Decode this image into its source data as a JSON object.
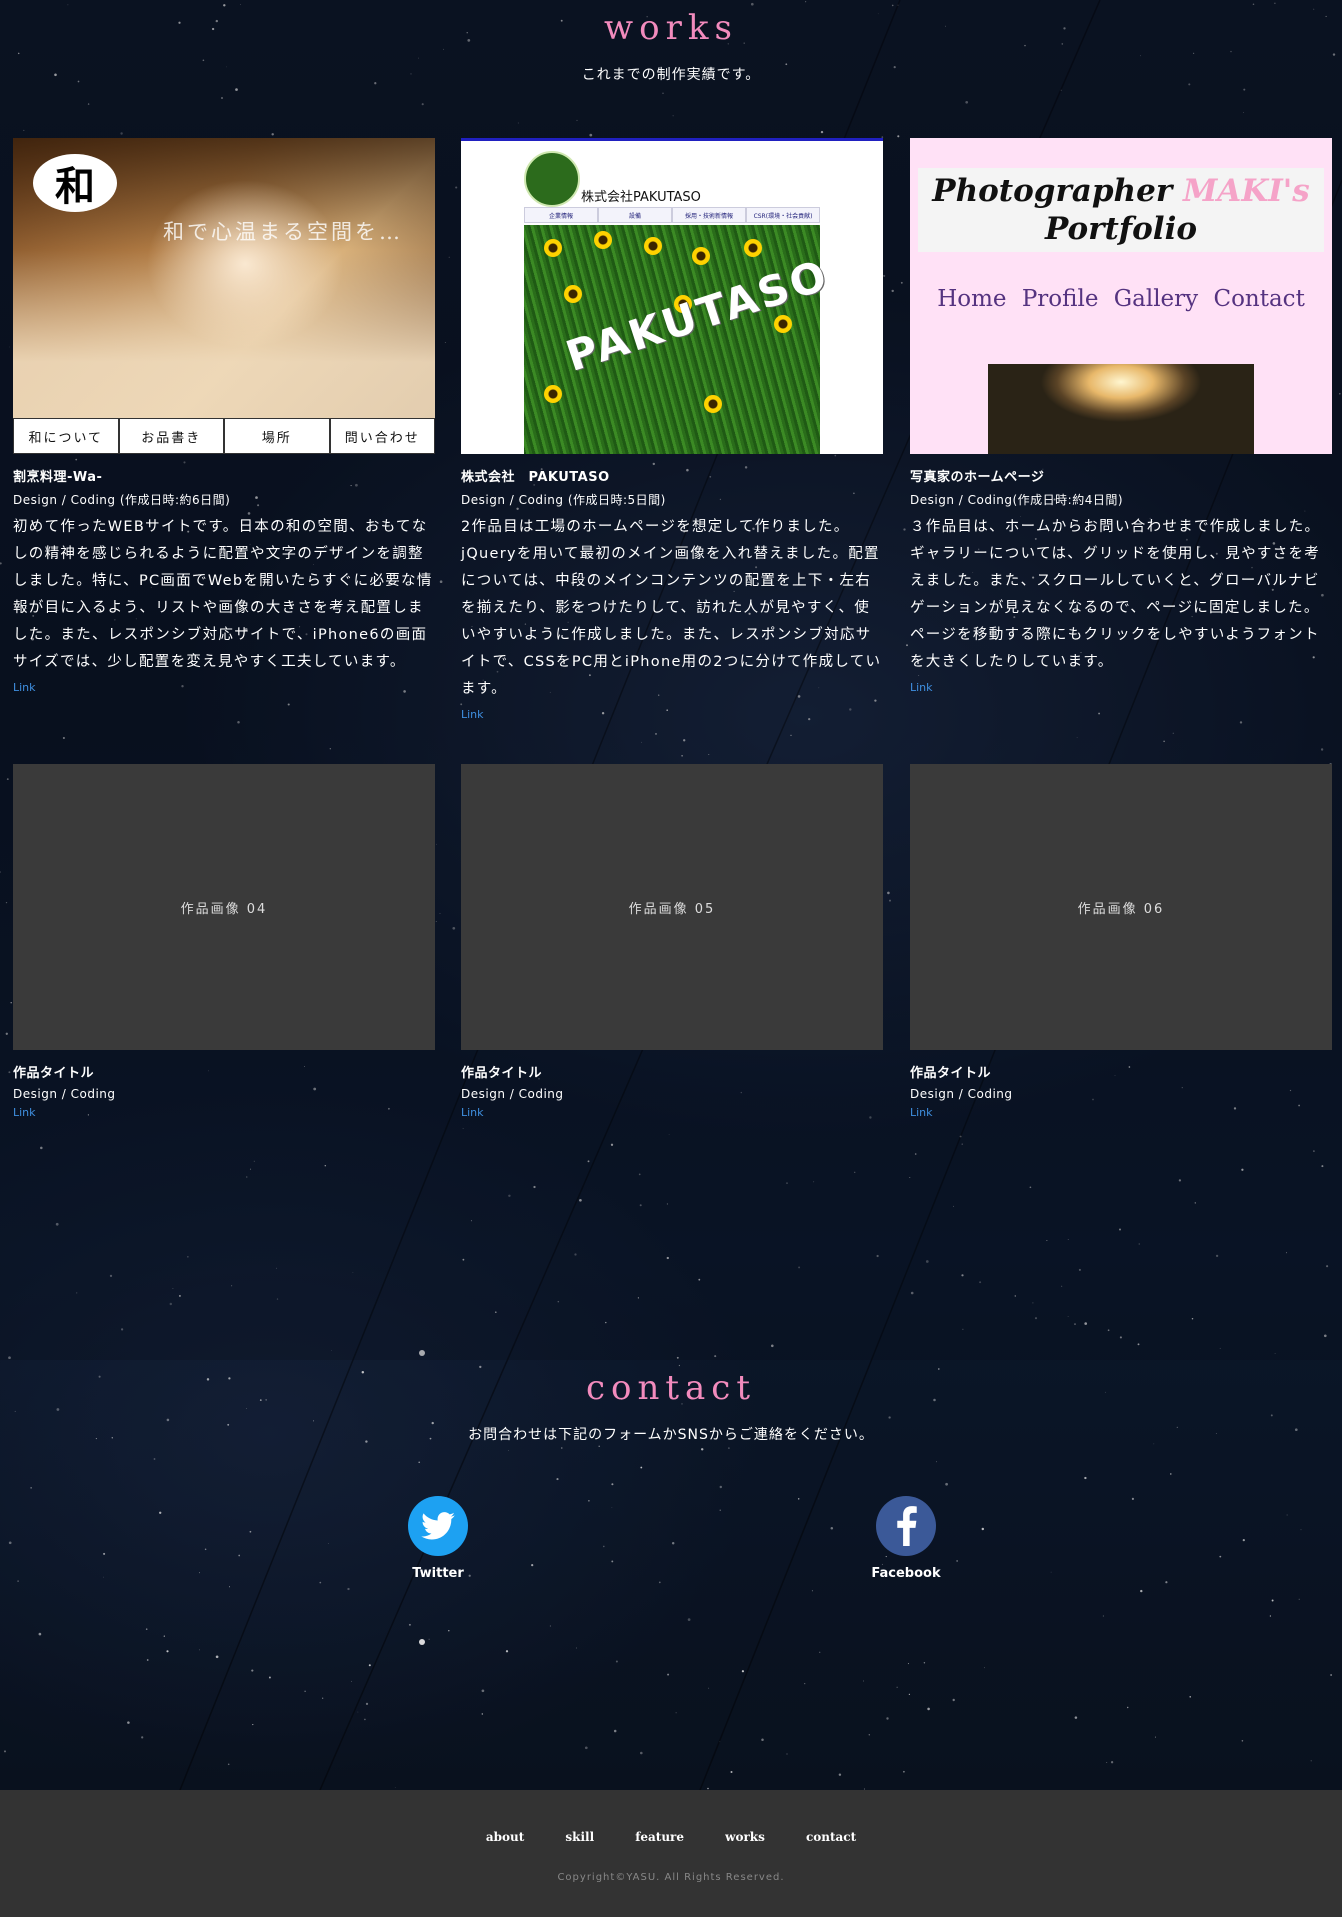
{
  "works": {
    "title": "works",
    "subtitle": "これまでの制作実績です。",
    "items": [
      {
        "title": "割烹料理-Wa-",
        "meta": "Design / Coding (作成日時:約6日間)",
        "desc": "初めて作ったWEBサイトです。日本の和の空間、おもてなしの精神を感じられるように配置や文字のデザインを調整しました。特に、PC画面でWebを開いたらすぐに必要な情報が目に入るよう、リストや画像の大きさを考え配置しました。また、レスポンシブ対応サイトで、iPhone6の画面サイズでは、少し配置を変え見やすく工夫しています。",
        "link": "Link",
        "thumb": {
          "logo": "和",
          "catch": "和で心温まる空間を…",
          "nav": [
            "和について",
            "お品書き",
            "場所",
            "問い合わせ"
          ]
        }
      },
      {
        "title": "株式会社　PAKUTASO",
        "meta": "Design / Coding (作成日時:5日間)",
        "desc": "2作品目は工場のホームページを想定して作りました。jQueryを用いて最初のメイン画像を入れ替えました。配置については、中段のメインコンテンツの配置を上下・左右を揃えたり、影をつけたりして、訪れた人が見やすく、使いやすいように作成しました。また、レスポンシブ対応サイトで、CSSをPC用とiPhone用の2つに分けて作成しています。",
        "link": "Link",
        "thumb": {
          "company": "株式会社PAKUTASO",
          "tabs": [
            "企業情報",
            "設備",
            "採用・技術新情報",
            "CSR(環境・社会貢献)"
          ],
          "hero_text": "PAKUTASO"
        }
      },
      {
        "title": "写真家のホームページ",
        "meta": "Design / Coding(作成日時:約4日間)",
        "desc": "３作品目は、ホームからお問い合わせまで作成しました。ギャラリーについては、グリッドを使用し、見やすさを考えました。また、スクロールしていくと、グローバルナビゲーションが見えなくなるので、ページに固定しました。ページを移動する際にもクリックをしやすいようフォントを大きくしたりしています。",
        "link": "Link",
        "thumb": {
          "heading1": "Photographer ",
          "heading_accent": "MAKI's",
          "heading2": "Portfolio",
          "menu": "Home  Profile  Gallery  Contact"
        }
      },
      {
        "placeholder": "作品画像 04",
        "title": "作品タイトル",
        "meta": "Design / Coding",
        "link": "Link"
      },
      {
        "placeholder": "作品画像 05",
        "title": "作品タイトル",
        "meta": "Design / Coding",
        "link": "Link"
      },
      {
        "placeholder": "作品画像 06",
        "title": "作品タイトル",
        "meta": "Design / Coding",
        "link": "Link"
      }
    ]
  },
  "contact": {
    "title": "contact",
    "subtitle": "お問合わせは下記のフォームかSNSからご連絡をください。",
    "twitter": {
      "label": "Twitter",
      "icon": "twitter-icon",
      "color": "#1da1f2"
    },
    "facebook": {
      "label": "Facebook",
      "icon": "facebook-icon",
      "color": "#3b5998"
    }
  },
  "footer": {
    "nav": [
      "about",
      "skill",
      "feature",
      "works",
      "contact"
    ],
    "copyright": "Copyright©YASU. All Rights Reserved."
  },
  "colors": {
    "accent": "#f28bbd",
    "link": "#3f8fe0",
    "footer_bg": "#333333"
  }
}
